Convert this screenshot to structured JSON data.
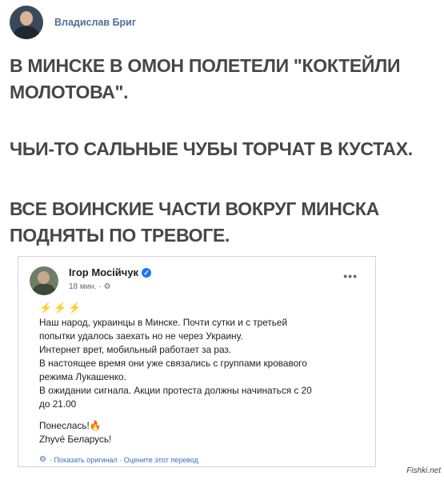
{
  "author": {
    "name": "Владислав Бриг"
  },
  "post_lines": [
    "В МИНСКЕ В ОМОН ПОЛЕТЕЛИ \"КОКТЕЙЛИ",
    "МОЛОТОВА\".",
    "ЧЬИ-ТО САЛЬНЫЕ ЧУБЫ ТОРЧАТ В КУСТАХ.",
    "ВСЕ ВОИНСКИЕ ЧАСТИ ВОКРУГ МИНСКА",
    "ПОДНЯТЫ ПО ТРЕВОГЕ."
  ],
  "embedded": {
    "name": "Ігор Мосійчук",
    "meta": "18 мин. · ",
    "more": "•••",
    "emoji": "⚡⚡⚡",
    "body": [
      "Наш народ, украинцы в Минске. Почти сутки и с третьей",
      "попытки удалось заехать но не через Украину.",
      "Интернет врет, мобильный работает за раз.",
      "В настоящее время они уже связались с группами кровавого",
      "режима Лукашенко.",
      "В ожидании сигнала. Акции протеста должны начинаться с 20",
      "до 21.00"
    ],
    "sig1": "Понеслась!",
    "sig2": "Zhyvé Беларусь!",
    "translate": "· Показать оригинал · Оцените этот перевод"
  },
  "watermark": "Fishki.net",
  "colors": {
    "author": "#4d6e99",
    "verified": "#1877f2",
    "link": "#3b6fbf"
  }
}
